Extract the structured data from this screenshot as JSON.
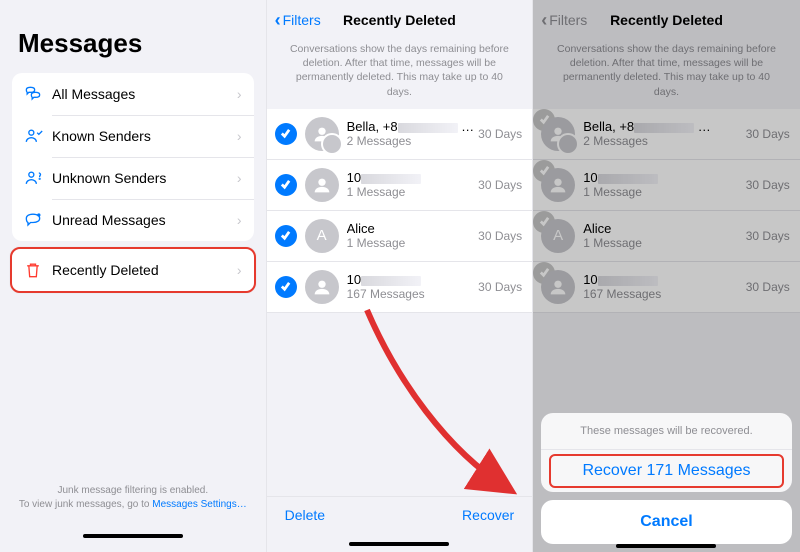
{
  "screen1": {
    "title": "Messages",
    "rows": [
      {
        "label": "All Messages",
        "icon": "bubbles"
      },
      {
        "label": "Known Senders",
        "icon": "person"
      },
      {
        "label": "Unknown Senders",
        "icon": "personq"
      },
      {
        "label": "Unread Messages",
        "icon": "chat"
      }
    ],
    "highlighted": {
      "label": "Recently Deleted",
      "icon": "trash"
    },
    "junk_line1": "Junk message filtering is enabled.",
    "junk_line2": "To view junk messages, go to ",
    "junk_link": "Messages Settings…"
  },
  "screen2": {
    "back": "Filters",
    "title": "Recently Deleted",
    "info": "Conversations show the days remaining before deletion. After that time, messages will be permanently deleted. This may take up to 40 days.",
    "conversations": [
      {
        "name_prefix": "Bella, +8",
        "truncated": true,
        "count": "2 Messages",
        "days": "30 Days",
        "avatar": "group",
        "initial": ""
      },
      {
        "name_prefix": "10",
        "truncated": true,
        "count": "1 Message",
        "days": "30 Days",
        "avatar": "silhouette",
        "initial": ""
      },
      {
        "name_prefix": "Alice",
        "truncated": false,
        "count": "1 Message",
        "days": "30 Days",
        "avatar": "initial",
        "initial": "A"
      },
      {
        "name_prefix": "10",
        "truncated": true,
        "count": "167 Messages",
        "days": "30 Days",
        "avatar": "silhouette",
        "initial": ""
      }
    ],
    "footer_delete": "Delete",
    "footer_recover": "Recover"
  },
  "screen3": {
    "sheet_msg": "These messages will be recovered.",
    "sheet_action": "Recover 171 Messages",
    "sheet_cancel": "Cancel"
  }
}
